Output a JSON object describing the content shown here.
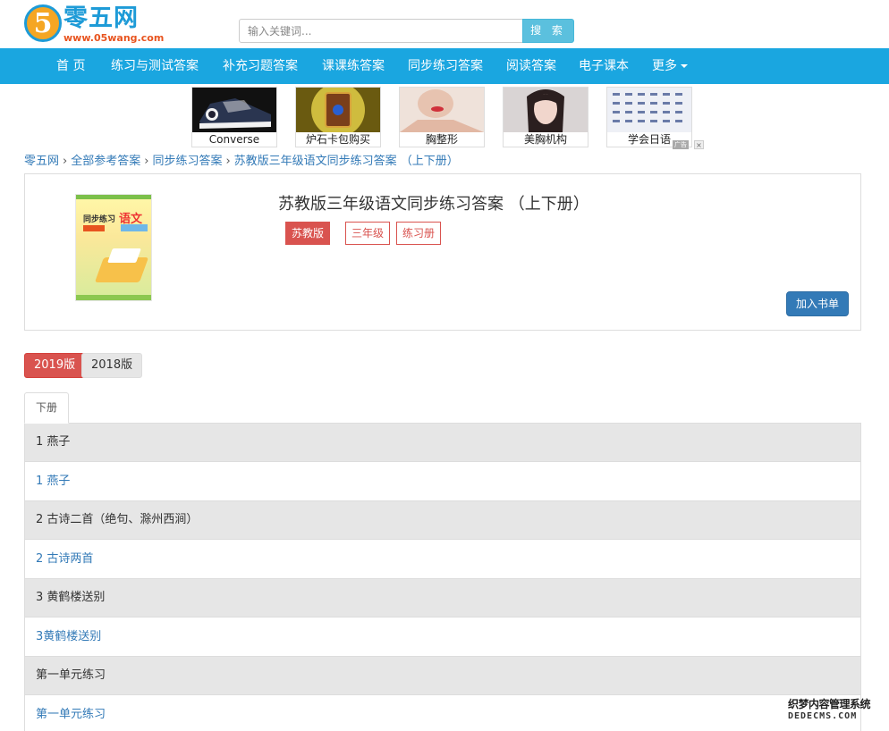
{
  "logo": {
    "badge": "5",
    "name": "零五网",
    "url": "www.05wang.com"
  },
  "search": {
    "placeholder": "输入关键词...",
    "button": "搜 索"
  },
  "nav": {
    "items": [
      "首 页",
      "练习与测试答案",
      "补充习题答案",
      "课课练答案",
      "同步练习答案",
      "阅读答案",
      "电子课本"
    ],
    "more": "更多"
  },
  "ads": {
    "items": [
      "Converse",
      "炉石卡包购买",
      "胸整形",
      "美胸机构",
      "学会日语"
    ],
    "mark": "广告",
    "close": "×"
  },
  "breadcrumb": [
    "零五网",
    "全部参考答案",
    "同步练习答案",
    "苏教版三年级语文同步练习答案 （上下册）"
  ],
  "book": {
    "title": "苏教版三年级语文同步练习答案 （上下册）",
    "tags": [
      "苏教版",
      "三年级",
      "练习册"
    ],
    "add_button": "加入书单",
    "cover_title": "同步练习",
    "cover_subject": "语文"
  },
  "years": [
    "2019版",
    "2018版"
  ],
  "tabs": [
    "下册"
  ],
  "chapters": [
    {
      "title": "1 燕子",
      "link": "1 燕子"
    },
    {
      "title": "2 古诗二首（绝句、滁州西涧）",
      "link": "2 古诗两首"
    },
    {
      "title": "3 黄鹤楼送别",
      "link": "3黄鹤楼送别"
    },
    {
      "title": "第一单元练习",
      "link": "第一单元练习"
    }
  ],
  "watermark": {
    "line1": "织梦内容管理系统",
    "line2": "DEDECMS.COM"
  },
  "colors": {
    "nav": "#1aa6e0",
    "danger": "#d9534f",
    "primary": "#337ab7",
    "info": "#5bc0de"
  }
}
